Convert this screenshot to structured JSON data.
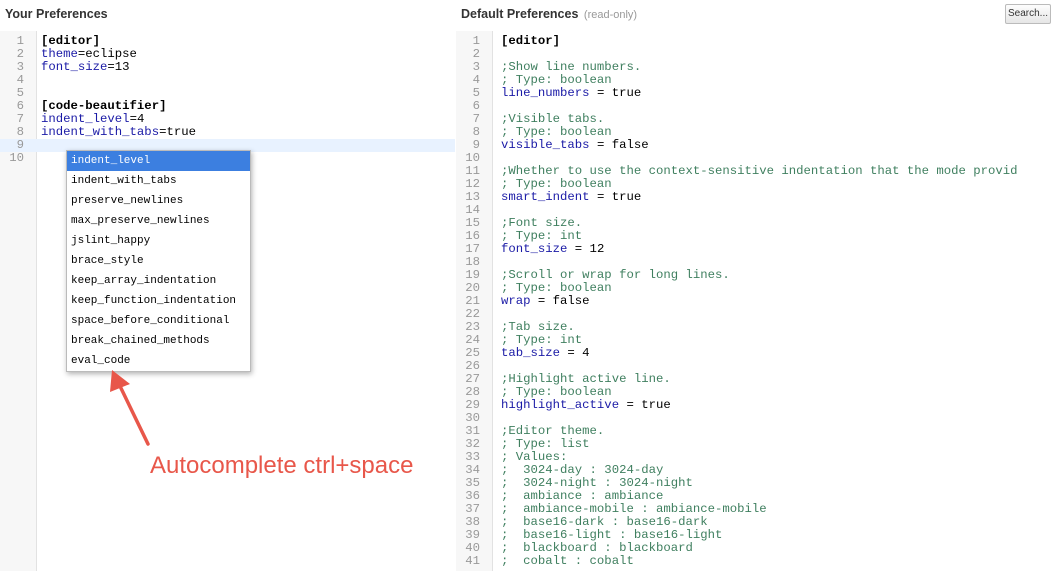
{
  "header": {
    "left_title": "Your Preferences",
    "right_title": "Default Preferences",
    "right_title_note": "(read-only)",
    "search_label": "Search..."
  },
  "left_editor": {
    "lines": [
      {
        "n": "1",
        "parts": [
          {
            "t": "[editor]",
            "c": "kw"
          }
        ]
      },
      {
        "n": "2",
        "parts": [
          {
            "t": "theme",
            "c": "key"
          },
          {
            "t": "=eclipse",
            "c": "eq"
          }
        ]
      },
      {
        "n": "3",
        "parts": [
          {
            "t": "font_size",
            "c": "key"
          },
          {
            "t": "=13",
            "c": "eq"
          }
        ]
      },
      {
        "n": "4",
        "parts": []
      },
      {
        "n": "5",
        "parts": []
      },
      {
        "n": "6",
        "parts": [
          {
            "t": "[code-beautifier]",
            "c": "kw"
          }
        ]
      },
      {
        "n": "7",
        "parts": [
          {
            "t": "indent_level",
            "c": "key"
          },
          {
            "t": "=4",
            "c": "eq"
          }
        ]
      },
      {
        "n": "8",
        "parts": [
          {
            "t": "indent_with_tabs",
            "c": "key"
          },
          {
            "t": "=true",
            "c": "eq"
          }
        ]
      },
      {
        "n": "9",
        "parts": [],
        "active": true
      },
      {
        "n": "10",
        "parts": []
      }
    ]
  },
  "autocomplete": {
    "items": [
      "indent_level",
      "indent_with_tabs",
      "preserve_newlines",
      "max_preserve_newlines",
      "jslint_happy",
      "brace_style",
      "keep_array_indentation",
      "keep_function_indentation",
      "space_before_conditional",
      "break_chained_methods",
      "eval_code"
    ],
    "selected_index": 0
  },
  "annotation": {
    "text": "Autocomplete ctrl+space",
    "color": "#e8574a"
  },
  "right_editor": {
    "lines": [
      {
        "n": "1",
        "parts": [
          {
            "t": "[editor]",
            "c": "kw"
          }
        ]
      },
      {
        "n": "2",
        "parts": []
      },
      {
        "n": "3",
        "parts": [
          {
            "t": ";Show line numbers.",
            "c": "cm"
          }
        ]
      },
      {
        "n": "4",
        "parts": [
          {
            "t": "; Type: boolean",
            "c": "cm"
          }
        ]
      },
      {
        "n": "5",
        "parts": [
          {
            "t": "line_numbers",
            "c": "key"
          },
          {
            "t": " = true",
            "c": "eq"
          }
        ]
      },
      {
        "n": "6",
        "parts": []
      },
      {
        "n": "7",
        "parts": [
          {
            "t": ";Visible tabs.",
            "c": "cm"
          }
        ]
      },
      {
        "n": "8",
        "parts": [
          {
            "t": "; Type: boolean",
            "c": "cm"
          }
        ]
      },
      {
        "n": "9",
        "parts": [
          {
            "t": "visible_tabs",
            "c": "key"
          },
          {
            "t": " = false",
            "c": "eq"
          }
        ]
      },
      {
        "n": "10",
        "parts": []
      },
      {
        "n": "11",
        "parts": [
          {
            "t": ";Whether to use the context-sensitive indentation that the mode provid",
            "c": "cm"
          }
        ]
      },
      {
        "n": "12",
        "parts": [
          {
            "t": "; Type: boolean",
            "c": "cm"
          }
        ]
      },
      {
        "n": "13",
        "parts": [
          {
            "t": "smart_indent",
            "c": "key"
          },
          {
            "t": " = true",
            "c": "eq"
          }
        ]
      },
      {
        "n": "14",
        "parts": []
      },
      {
        "n": "15",
        "parts": [
          {
            "t": ";Font size.",
            "c": "cm"
          }
        ]
      },
      {
        "n": "16",
        "parts": [
          {
            "t": "; Type: int",
            "c": "cm"
          }
        ]
      },
      {
        "n": "17",
        "parts": [
          {
            "t": "font_size",
            "c": "key"
          },
          {
            "t": " = 12",
            "c": "eq"
          }
        ]
      },
      {
        "n": "18",
        "parts": []
      },
      {
        "n": "19",
        "parts": [
          {
            "t": ";Scroll or wrap for long lines.",
            "c": "cm"
          }
        ]
      },
      {
        "n": "20",
        "parts": [
          {
            "t": "; Type: boolean",
            "c": "cm"
          }
        ]
      },
      {
        "n": "21",
        "parts": [
          {
            "t": "wrap",
            "c": "key"
          },
          {
            "t": " = false",
            "c": "eq"
          }
        ]
      },
      {
        "n": "22",
        "parts": []
      },
      {
        "n": "23",
        "parts": [
          {
            "t": ";Tab size.",
            "c": "cm"
          }
        ]
      },
      {
        "n": "24",
        "parts": [
          {
            "t": "; Type: int",
            "c": "cm"
          }
        ]
      },
      {
        "n": "25",
        "parts": [
          {
            "t": "tab_size",
            "c": "key"
          },
          {
            "t": " = 4",
            "c": "eq"
          }
        ]
      },
      {
        "n": "26",
        "parts": []
      },
      {
        "n": "27",
        "parts": [
          {
            "t": ";Highlight active line.",
            "c": "cm"
          }
        ]
      },
      {
        "n": "28",
        "parts": [
          {
            "t": "; Type: boolean",
            "c": "cm"
          }
        ]
      },
      {
        "n": "29",
        "parts": [
          {
            "t": "highlight_active",
            "c": "key"
          },
          {
            "t": " = true",
            "c": "eq"
          }
        ]
      },
      {
        "n": "30",
        "parts": []
      },
      {
        "n": "31",
        "parts": [
          {
            "t": ";Editor theme.",
            "c": "cm"
          }
        ]
      },
      {
        "n": "32",
        "parts": [
          {
            "t": "; Type: list",
            "c": "cm"
          }
        ]
      },
      {
        "n": "33",
        "parts": [
          {
            "t": "; Values:",
            "c": "cm"
          }
        ]
      },
      {
        "n": "34",
        "parts": [
          {
            "t": ";  3024-day : 3024-day",
            "c": "cm"
          }
        ]
      },
      {
        "n": "35",
        "parts": [
          {
            "t": ";  3024-night : 3024-night",
            "c": "cm"
          }
        ]
      },
      {
        "n": "36",
        "parts": [
          {
            "t": ";  ambiance : ambiance",
            "c": "cm"
          }
        ]
      },
      {
        "n": "37",
        "parts": [
          {
            "t": ";  ambiance-mobile : ambiance-mobile",
            "c": "cm"
          }
        ]
      },
      {
        "n": "38",
        "parts": [
          {
            "t": ";  base16-dark : base16-dark",
            "c": "cm"
          }
        ]
      },
      {
        "n": "39",
        "parts": [
          {
            "t": ";  base16-light : base16-light",
            "c": "cm"
          }
        ]
      },
      {
        "n": "40",
        "parts": [
          {
            "t": ";  blackboard : blackboard",
            "c": "cm"
          }
        ]
      },
      {
        "n": "41",
        "parts": [
          {
            "t": ";  cobalt : cobalt",
            "c": "cm"
          }
        ]
      }
    ]
  }
}
